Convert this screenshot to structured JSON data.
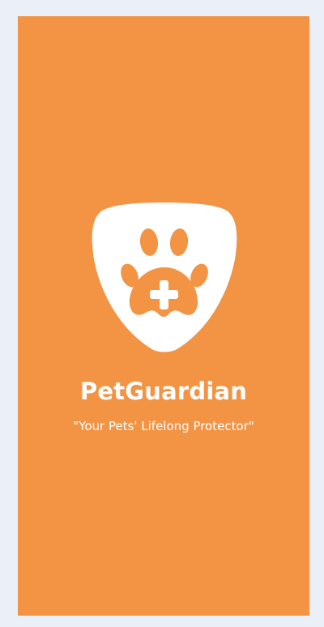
{
  "splash": {
    "app_name": "PetGuardian",
    "tagline": "\"Your Pets' Lifelong Protector\"",
    "logo_icon": "shield-paw-plus-icon"
  },
  "colors": {
    "background": "#eaeff8",
    "brand_orange": "#f39445",
    "logo_white": "#ffffff"
  }
}
